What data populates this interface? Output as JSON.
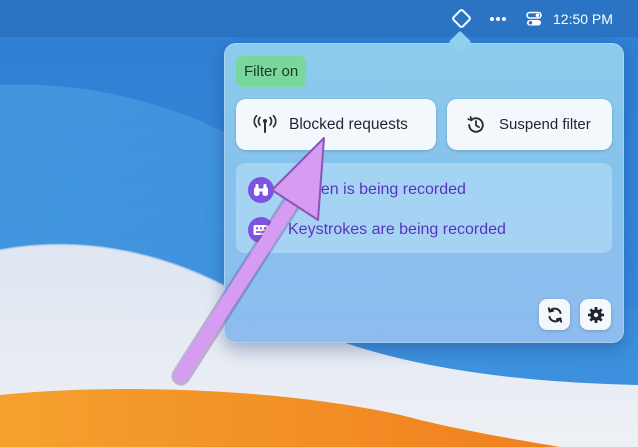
{
  "menubar": {
    "clock": "12:50 PM",
    "icons": [
      "filter-diamond-icon",
      "more-dots-icon",
      "control-center-icon"
    ]
  },
  "popover": {
    "status": "Filter on",
    "buttons": {
      "blocked": {
        "label": "Blocked requests",
        "icon": "antenna-icon"
      },
      "suspend": {
        "label": "Suspend filter",
        "icon": "history-icon"
      }
    },
    "records": [
      {
        "text": "Screen is being recorded",
        "icon": "binoculars-icon"
      },
      {
        "text": "Keystrokes are being recorded",
        "icon": "keyboard-icon"
      }
    ],
    "footer_icons": [
      "refresh-icon",
      "settings-gear-icon"
    ]
  },
  "colors": {
    "status_green": "#79d79b",
    "record_purple": "#7d54e0",
    "record_text": "#5833c2",
    "annotation_arrow": "#d59cf2"
  }
}
